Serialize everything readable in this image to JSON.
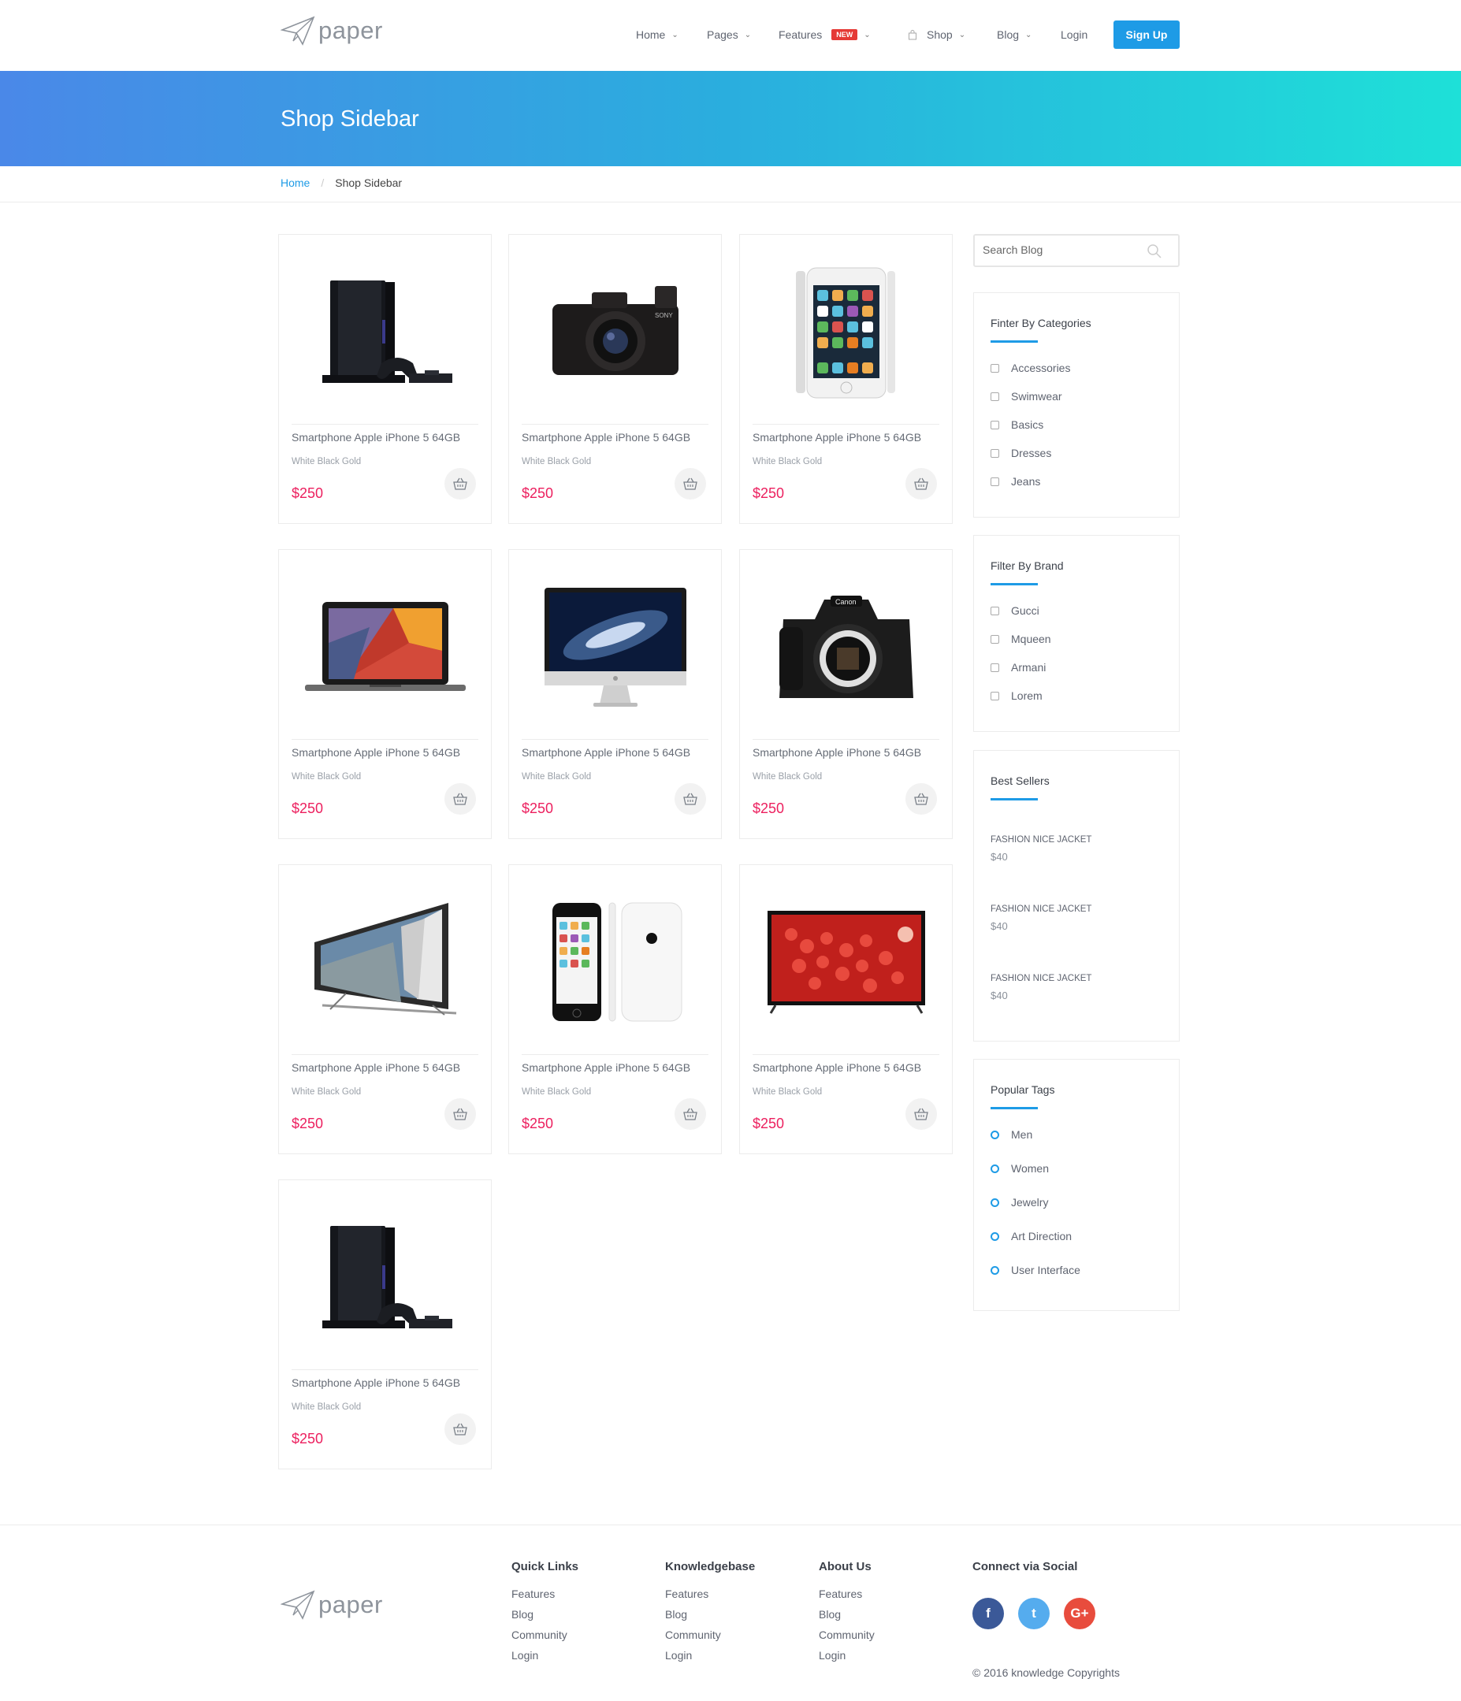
{
  "header": {
    "logo_text": "paper",
    "nav": [
      {
        "label": "Home"
      },
      {
        "label": "Pages"
      },
      {
        "label": "Features",
        "badge": "NEW"
      },
      {
        "label": "Shop"
      },
      {
        "label": "Blog"
      },
      {
        "label": "Login"
      }
    ],
    "signup_label": "Sign Up"
  },
  "banner": {
    "title": "Shop Sidebar"
  },
  "breadcrumb": {
    "home": "Home",
    "separator": "/",
    "current": "Shop Sidebar"
  },
  "products": [
    {
      "title": "Smartphone Apple iPhone 5 64GB",
      "subtitle": "White Black Gold",
      "price": "$250",
      "image": "game-console"
    },
    {
      "title": "Smartphone Apple iPhone 5 64GB",
      "subtitle": "White Black Gold",
      "price": "$250",
      "image": "compact-camera"
    },
    {
      "title": "Smartphone Apple iPhone 5 64GB",
      "subtitle": "White Black Gold",
      "price": "$250",
      "image": "smartphone-silver"
    },
    {
      "title": "Smartphone Apple iPhone 5 64GB",
      "subtitle": "White Black Gold",
      "price": "$250",
      "image": "laptop"
    },
    {
      "title": "Smartphone Apple iPhone 5 64GB",
      "subtitle": "White Black Gold",
      "price": "$250",
      "image": "desktop-monitor"
    },
    {
      "title": "Smartphone Apple iPhone 5 64GB",
      "subtitle": "White Black Gold",
      "price": "$250",
      "image": "dslr-camera"
    },
    {
      "title": "Smartphone Apple iPhone 5 64GB",
      "subtitle": "White Black Gold",
      "price": "$250",
      "image": "curved-tv"
    },
    {
      "title": "Smartphone Apple iPhone 5 64GB",
      "subtitle": "White Black Gold",
      "price": "$250",
      "image": "smartphone-pair"
    },
    {
      "title": "Smartphone Apple iPhone 5 64GB",
      "subtitle": "White Black Gold",
      "price": "$250",
      "image": "flat-tv"
    },
    {
      "title": "Smartphone Apple iPhone 5 64GB",
      "subtitle": "White Black Gold",
      "price": "$250",
      "image": "game-console"
    }
  ],
  "sidebar": {
    "search_placeholder": "Search Blog",
    "categories": {
      "title": "Finter By Categories",
      "items": [
        "Accessories",
        "Swimwear",
        "Basics",
        "Dresses",
        "Jeans"
      ]
    },
    "brands": {
      "title": "Filter By Brand",
      "items": [
        "Gucci",
        "Mqueen",
        "Armani",
        "Lorem"
      ]
    },
    "best_sellers": {
      "title": "Best Sellers",
      "items": [
        {
          "name": "FASHION NICE JACKET",
          "price": "$40"
        },
        {
          "name": "FASHION NICE JACKET",
          "price": "$40"
        },
        {
          "name": "FASHION NICE JACKET",
          "price": "$40"
        }
      ]
    },
    "tags": {
      "title": "Popular Tags",
      "items": [
        "Men",
        "Women",
        "Jewelry",
        "Art Direction",
        "User Interface"
      ]
    }
  },
  "footer": {
    "logo_text": "paper",
    "columns": [
      {
        "title": "Quick Links",
        "links": [
          "Features",
          "Blog",
          "Community",
          "Login"
        ]
      },
      {
        "title": "Knowledgebase",
        "links": [
          "Features",
          "Blog",
          "Community",
          "Login"
        ]
      },
      {
        "title": "About Us",
        "links": [
          "Features",
          "Blog",
          "Community",
          "Login"
        ]
      }
    ],
    "social_title": "Connect via Social",
    "social": [
      {
        "glyph": "f",
        "color": "#3b5998",
        "icon": "facebook-icon"
      },
      {
        "glyph": "t",
        "color": "#55acee",
        "icon": "twitter-icon"
      },
      {
        "glyph": "G+",
        "color": "#e84c3d",
        "icon": "google-plus-icon"
      }
    ],
    "copyright": "© 2016 knowledge Copyrights"
  }
}
